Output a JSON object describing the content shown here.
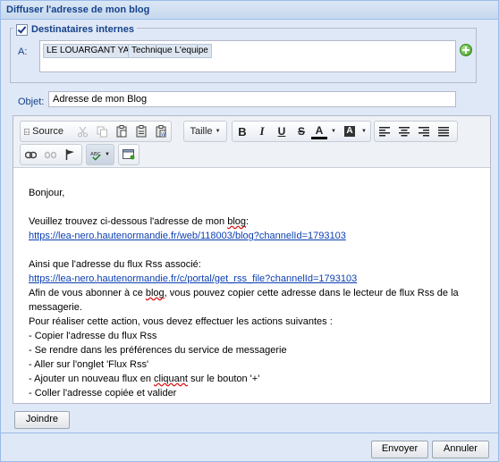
{
  "window": {
    "title": "Diffuser l'adresse de mon blog"
  },
  "recipients": {
    "legend": "Destinataires internes",
    "to_label": "A:",
    "chips": [
      "LE LOUARGANT YANN",
      "Technique L'equipe"
    ]
  },
  "subject": {
    "label": "Objet:",
    "value": "Adresse de mon Blog"
  },
  "toolbar": {
    "source_label": "Source",
    "size_label": "Taille",
    "bold": "B",
    "italic": "I",
    "underline": "U",
    "strike": "S",
    "text_color": "A",
    "bg_color": "A"
  },
  "body": {
    "greeting": "Bonjour,",
    "intro_pre": "Veuillez trouvez ci-dessous l'adresse de mon ",
    "intro_word": "blog",
    "intro_post": ":",
    "blog_url": "https://lea-nero.hautenormandie.fr/web/118003/blog?channelId=1793103",
    "rss_intro": "Ainsi que l'adresse du flux Rss associé:",
    "rss_url": "https://lea-nero.hautenormandie.fr/c/portal/get_rss_file?channelId=1793103",
    "para1_pre": "Afin de vous abonner à ce ",
    "para1_word": "blog",
    "para1_post": ", vous pouvez copier cette adresse dans le lecteur de flux Rss de la",
    "para1_line2": "messagerie.",
    "steps_intro": "Pour réaliser cette action, vous devez effectuer les actions suivantes :",
    "step1": "- Copier l'adresse du flux Rss",
    "step2": "- Se rendre dans les préférences du service de messagerie",
    "step3": "- Aller sur l'onglet 'Flux Rss'",
    "step4_pre": "- Ajouter un nouveau flux en ",
    "step4_word": "cliquant",
    "step4_post": " sur le bouton '+'",
    "step5": "- Coller l'adresse copiée et valider"
  },
  "buttons": {
    "attach": "Joindre",
    "send": "Envoyer",
    "cancel": "Annuler"
  },
  "colors": {
    "title_text": "#15428b",
    "dialog_bg": "#dfe8f6",
    "link": "#0b3fb3",
    "add_icon": "#3d9a1f"
  }
}
